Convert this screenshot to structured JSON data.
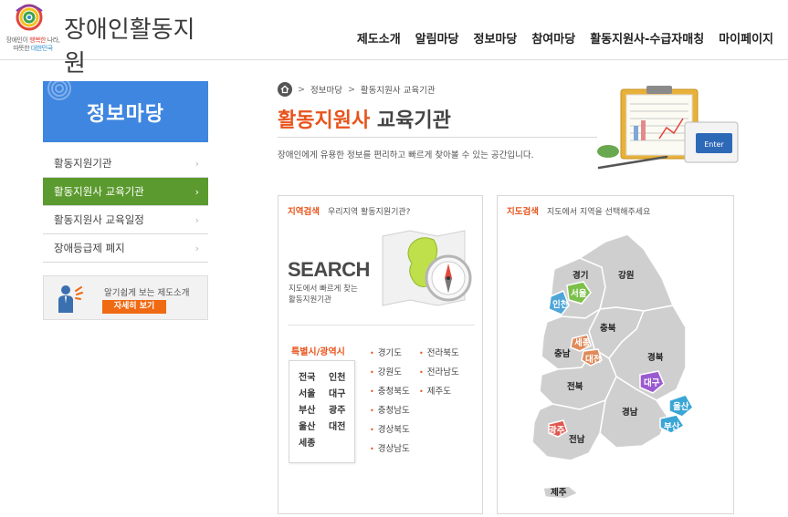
{
  "logo": {
    "title": "장애인활동지원",
    "tagline_1a": "장애인이 ",
    "tagline_1b": "행복한",
    "tagline_1c": " 나라,",
    "tagline_2a": "따뜻한 ",
    "tagline_2b": "대한민국"
  },
  "gnb": [
    "제도소개",
    "알림마당",
    "정보마당",
    "참여마당",
    "활동지원사-수급자매칭",
    "마이페이지"
  ],
  "sidebar": {
    "title": "정보마당",
    "items": [
      {
        "label": "활동지원기관"
      },
      {
        "label": "활동지원사 교육기관"
      },
      {
        "label": "활동지원사 교육일정"
      },
      {
        "label": "장애등급제 폐지"
      }
    ],
    "promo_text": "알기쉽게 보는 제도소개",
    "promo_button": "자세히 보기"
  },
  "breadcrumb": [
    "정보마당",
    "활동지원사 교육기관"
  ],
  "page": {
    "title_orange": "활동지원사",
    "title_dark": "교육기관",
    "description": "장애인에게 유용한 정보를 편리하고 빠르게 찾아볼 수 있는 공간입니다.",
    "enter_key": "Enter"
  },
  "region_search": {
    "heading": "지역검색",
    "subheading": "우리지역 활동지원기관?",
    "search_big": "SEARCH",
    "search_sub_1": "지도에서 빠르게 찾는",
    "search_sub_2": "활동지원기관",
    "metro_label": "특별시/광역시",
    "metro": [
      "전국",
      "인천",
      "서울",
      "대구",
      "부산",
      "광주",
      "울산",
      "대전",
      "세종"
    ],
    "provinces_col1": [
      "경기도",
      "강원도",
      "충청북도",
      "충청남도",
      "경상북도",
      "경상남도"
    ],
    "provinces_col2": [
      "전라북도",
      "전라남도",
      "제주도"
    ]
  },
  "map_search": {
    "heading": "지도검색",
    "subheading": "지도에서 지역을 선택해주세요",
    "regions": {
      "gyeonggi": "경기",
      "gangwon": "강원",
      "incheon": "인천",
      "seoul": "서울",
      "chungbuk": "충북",
      "sejong": "세종",
      "chungnam": "충남",
      "daejeon": "대전",
      "gyeongbuk": "경북",
      "daegu": "대구",
      "jeonbuk": "전북",
      "gyeongnam": "경남",
      "ulsan": "울산",
      "busan": "부산",
      "gwangju": "광주",
      "jeonnam": "전남",
      "jeju": "제주"
    }
  },
  "colors": {
    "accent_orange": "#e8541c",
    "sidebar_blue": "#3f86e0",
    "active_green": "#5b9a2e",
    "map_gray": "#cfcfcf",
    "incheon_teal": "#4ea6d8",
    "seoul_green": "#7cc04a",
    "sejong_daejeon_orange": "#e08a5a",
    "daegu_purple": "#9b5bd0",
    "ulsan_busan_cyan": "#3aa6d6",
    "gwangju_red": "#e0574f"
  }
}
